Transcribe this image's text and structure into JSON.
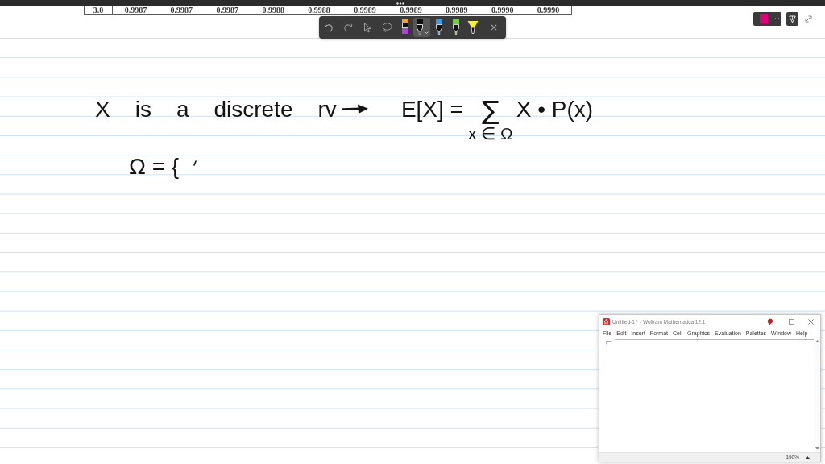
{
  "table": {
    "rows": [
      {
        "cells": [
          "3.0",
          "0.9987",
          "0.9987",
          "0.9987",
          "0.9988",
          "0.9988",
          "0.9989",
          "0.9989",
          "0.9989",
          "0.9990",
          "0.9990"
        ]
      }
    ]
  },
  "ink_toolbar": {
    "actions": [
      {
        "kind": "undo"
      },
      {
        "kind": "redo"
      }
    ],
    "tools": [
      {
        "kind": "select",
        "selected": false
      },
      {
        "kind": "lasso",
        "selected": false
      },
      {
        "kind": "pencil",
        "color": "#b23ee0",
        "selected": false
      },
      {
        "kind": "pen",
        "color": "#111111",
        "selected": true
      },
      {
        "kind": "pen",
        "color": "#3d9be0",
        "selected": false
      },
      {
        "kind": "pen",
        "color": "#6fcf3f",
        "selected": false
      },
      {
        "kind": "highlighter",
        "color": "#f3ef3b",
        "selected": false
      }
    ],
    "close": "×"
  },
  "pen_color": {
    "color": "#e4007c"
  },
  "note": {
    "statement": [
      "X",
      "is",
      "a",
      "discrete",
      "rv"
    ],
    "expectation": {
      "lhs": "E[X] =",
      "operator": "∑",
      "subscript": "x ∈ Ω",
      "summand": "X • P(x)"
    },
    "sample_space": "Ω = {"
  },
  "mathematica_window": {
    "title": "Untitled-1 * - Wolfram Mathematica 12.1",
    "menu": [
      "File",
      "Edit",
      "Insert",
      "Format",
      "Cell",
      "Graphics",
      "Evaluation",
      "Palettes",
      "Window",
      "Help"
    ],
    "zoom": "190%"
  }
}
